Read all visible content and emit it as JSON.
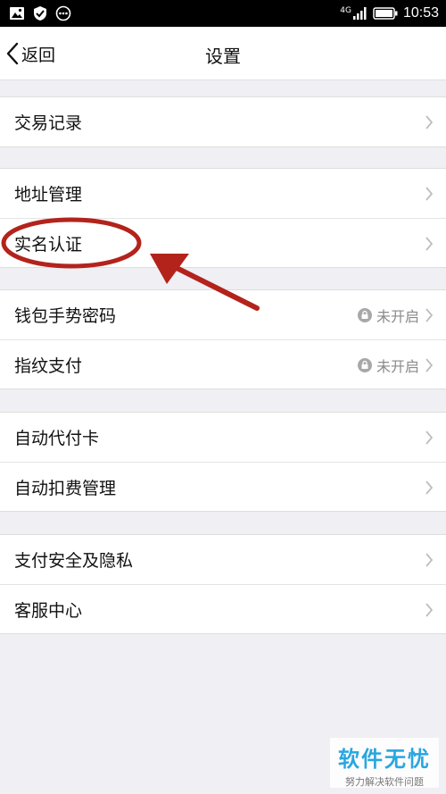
{
  "status_bar": {
    "network": "4G",
    "time": "10:53"
  },
  "nav": {
    "back_label": "返回",
    "title": "设置"
  },
  "groups": [
    {
      "items": [
        {
          "label": "交易记录"
        }
      ]
    },
    {
      "items": [
        {
          "label": "地址管理"
        },
        {
          "label": "实名认证"
        }
      ]
    },
    {
      "items": [
        {
          "label": "钱包手势密码",
          "status": "未开启"
        },
        {
          "label": "指纹支付",
          "status": "未开启"
        }
      ]
    },
    {
      "items": [
        {
          "label": "自动代付卡"
        },
        {
          "label": "自动扣费管理"
        }
      ]
    },
    {
      "items": [
        {
          "label": "支付安全及隐私"
        },
        {
          "label": "客服中心"
        }
      ]
    }
  ],
  "watermark": {
    "title": "软件无忧",
    "subtitle": "努力解决软件问题"
  },
  "colors": {
    "annotation": "#b3231c",
    "watermark": "#29a6e0",
    "background": "#efeff4"
  },
  "icons": [
    "image-icon",
    "shield-icon",
    "more-icon",
    "signal-icon",
    "battery-icon",
    "back-chevron-icon",
    "chevron-right-icon",
    "lock-icon"
  ]
}
